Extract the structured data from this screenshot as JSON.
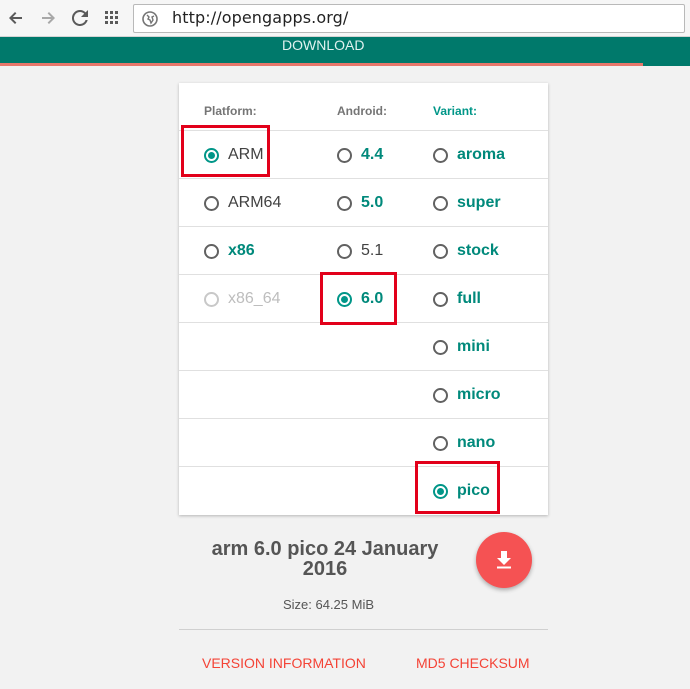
{
  "browser": {
    "url": "http://opengapps.org/"
  },
  "appbar": {
    "download_label": "DOWNLOAD"
  },
  "selector": {
    "headers": {
      "platform": "Platform:",
      "android": "Android:",
      "variant": "Variant:"
    },
    "platforms": [
      {
        "label": "ARM",
        "state": "checked"
      },
      {
        "label": "ARM64",
        "state": "unchecked"
      },
      {
        "label": "x86",
        "state": "unchecked"
      },
      {
        "label": "x86_64",
        "state": "disabled"
      }
    ],
    "android_versions": [
      {
        "label": "4.4",
        "state": "unchecked"
      },
      {
        "label": "5.0",
        "state": "unchecked"
      },
      {
        "label": "5.1",
        "state": "unchecked"
      },
      {
        "label": "6.0",
        "state": "checked"
      }
    ],
    "variants": [
      {
        "label": "aroma",
        "state": "unchecked"
      },
      {
        "label": "super",
        "state": "unchecked"
      },
      {
        "label": "stock",
        "state": "unchecked"
      },
      {
        "label": "full",
        "state": "unchecked"
      },
      {
        "label": "mini",
        "state": "unchecked"
      },
      {
        "label": "micro",
        "state": "unchecked"
      },
      {
        "label": "nano",
        "state": "unchecked"
      },
      {
        "label": "pico",
        "state": "checked"
      }
    ]
  },
  "summary": {
    "title_line1": "arm 6.0 pico 24 January",
    "title_line2": "2016",
    "size": "Size: 64.25 MiB"
  },
  "links": {
    "version_info": "VERSION INFORMATION",
    "md5": "MD5 CHECKSUM"
  },
  "colors": {
    "primary": "#00796b",
    "accent_teal": "#009688",
    "fab_red": "#f55253",
    "link_red": "#f44336",
    "highlight_red": "#e2001a"
  }
}
